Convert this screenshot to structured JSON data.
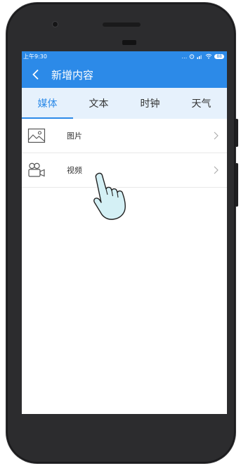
{
  "status_bar": {
    "time": "上午9:30",
    "battery": "88"
  },
  "header": {
    "title": "新增内容",
    "back_icon": "chevron-left-icon"
  },
  "tabs": [
    {
      "label": "媒体",
      "active": true
    },
    {
      "label": "文本",
      "active": false
    },
    {
      "label": "时钟",
      "active": false
    },
    {
      "label": "天气",
      "active": false
    }
  ],
  "list": [
    {
      "label": "图片",
      "icon": "image-icon"
    },
    {
      "label": "视频",
      "icon": "video-camera-icon"
    }
  ],
  "colors": {
    "primary": "#2c8ae8",
    "tab_background": "#e6f1fc",
    "phone_body": "#2c2c2e"
  }
}
